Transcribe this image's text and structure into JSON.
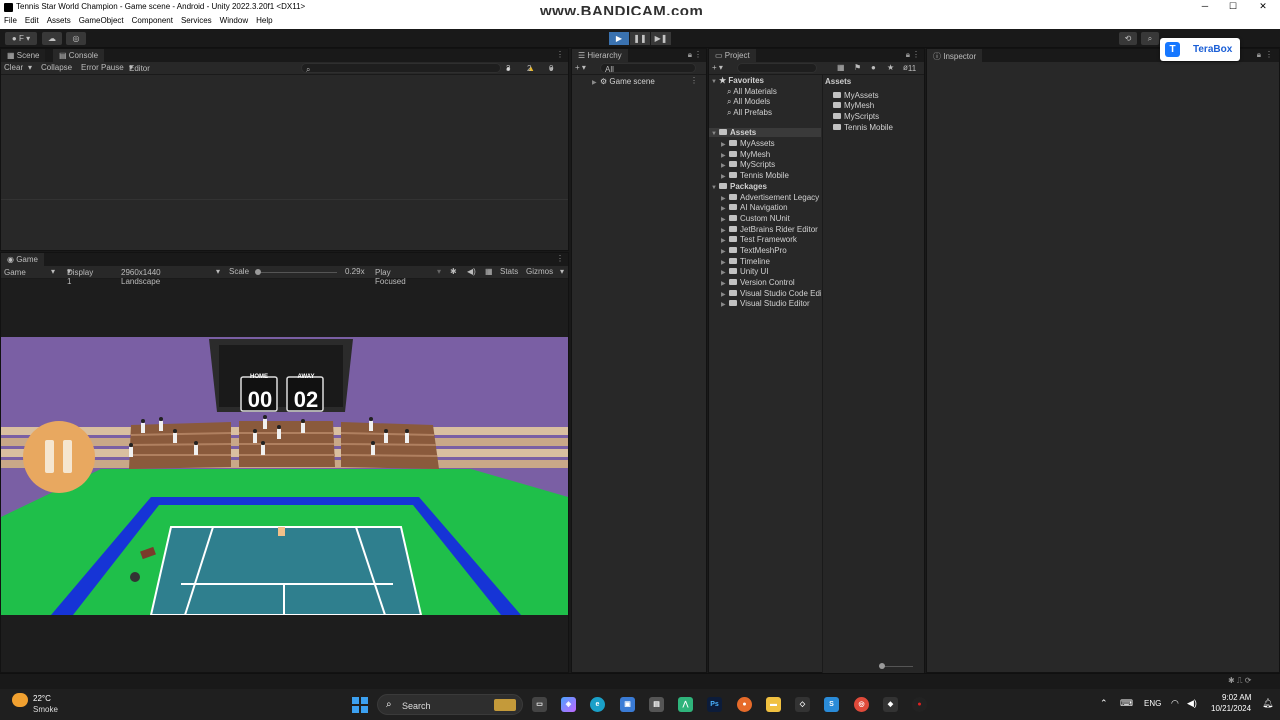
{
  "window": {
    "title": "Tennis Star World Champion - Game scene - Android - Unity 2022.3.20f1 <DX11>",
    "watermark": "www.BANDICAM.com",
    "minimize": "─",
    "maximize": "☐",
    "close": "✕"
  },
  "menu": [
    "File",
    "Edit",
    "Assets",
    "GameObject",
    "Component",
    "Services",
    "Window",
    "Help"
  ],
  "toolbar": {
    "account_label": "F",
    "play": "▶",
    "pause": "❚❚",
    "step": "▶❚"
  },
  "terabox": {
    "label": "TeraBox",
    "icon_letter": "T"
  },
  "top_left_panel": {
    "tabs": [
      "Scene",
      "Console"
    ],
    "console_toolbar": {
      "clear": "Clear",
      "collapse": "Collapse",
      "error_pause": "Error Pause",
      "editor": "Editor",
      "log_count": "3",
      "warn_count": "2",
      "error_count": "0"
    }
  },
  "game_panel": {
    "tab": "Game",
    "display_mode": "Game",
    "display": "Display 1",
    "resolution": "2960x1440 Landscape",
    "scale_label": "Scale",
    "scale_value": "0.29x",
    "play_focused": "Play Focused",
    "stats": "Stats",
    "gizmos": "Gizmos",
    "scoreboard": {
      "home_label": "HOME",
      "away_label": "AWAY",
      "home_score": "00",
      "away_score": "02"
    }
  },
  "hierarchy": {
    "tab": "Hierarchy",
    "search_placeholder": "All",
    "root": "Game scene"
  },
  "project": {
    "tab": "Project",
    "badge": "11",
    "favorites_header": "Favorites",
    "favorites": [
      "All Materials",
      "All Models",
      "All Prefabs"
    ],
    "assets_header": "Assets",
    "assets": [
      "MyAssets",
      "MyMesh",
      "MyScripts",
      "Tennis Mobile"
    ],
    "packages_header": "Packages",
    "packages": [
      "Advertisement Legacy",
      "AI Navigation",
      "Custom NUnit",
      "JetBrains Rider Editor",
      "Test Framework",
      "TextMeshPro",
      "Timeline",
      "Unity UI",
      "Version Control",
      "Visual Studio Code Editor",
      "Visual Studio Editor"
    ],
    "right_header": "Assets",
    "right_items": [
      "MyAssets",
      "MyMesh",
      "MyScripts",
      "Tennis Mobile"
    ]
  },
  "inspector": {
    "tab": "Inspector"
  },
  "taskbar": {
    "weather_temp": "22°C",
    "weather_desc": "Smoke",
    "search": "Search",
    "lang": "ENG",
    "time": "9:02 AM",
    "date": "10/21/2024"
  },
  "colors": {
    "accent": "#3a72b0",
    "court": "#2f7f8e",
    "grass": "#1fbf4a",
    "wall": "#7a5fa4",
    "terabox": "#1677ff"
  }
}
